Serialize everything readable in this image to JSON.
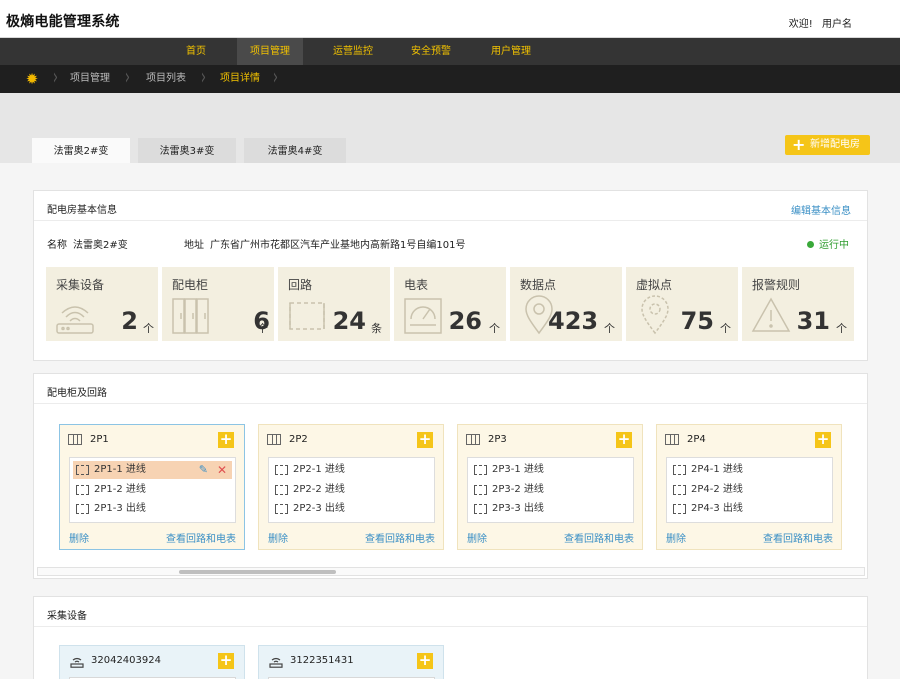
{
  "header": {
    "title": "极熵电能管理系统",
    "welcome": "欢迎!",
    "username": "用户名"
  },
  "nav": {
    "items": [
      "首页",
      "项目管理",
      "运营监控",
      "安全预警",
      "用户管理"
    ],
    "active": "项目管理"
  },
  "breadcrumb": {
    "items": [
      "项目管理",
      "项目列表",
      "项目详情"
    ]
  },
  "tabs": [
    "法雷奥2#变",
    "法雷奥3#变",
    "法雷奥4#变"
  ],
  "add_room_label": "新增配电房",
  "basic": {
    "title": "配电房基本信息",
    "edit_label": "编辑基本信息",
    "name_label": "名称",
    "name": "法雷奥2#变",
    "address_label": "地址",
    "address": "广东省广州市花都区汽车产业基地内高新路1号自编101号",
    "status": "运行中"
  },
  "stats": [
    {
      "label": "采集设备",
      "value": "2",
      "unit": "个",
      "icon": "wifi-router-icon"
    },
    {
      "label": "配电柜",
      "value": "6",
      "unit": "个",
      "icon": "cabinet-icon"
    },
    {
      "label": "回路",
      "value": "24",
      "unit": "条",
      "icon": "loop-icon"
    },
    {
      "label": "电表",
      "value": "26",
      "unit": "个",
      "icon": "meter-icon"
    },
    {
      "label": "数据点",
      "value": "423",
      "unit": "个",
      "icon": "map-pin-icon"
    },
    {
      "label": "虚拟点",
      "value": "75",
      "unit": "个",
      "icon": "virtual-point-icon"
    },
    {
      "label": "报警规则",
      "value": "31",
      "unit": "个",
      "icon": "warning-icon"
    }
  ],
  "cabinets": {
    "title": "配电柜及回路",
    "delete_label": "删除",
    "view_label": "查看回路和电表",
    "items": [
      {
        "name": "2P1",
        "loops": [
          "2P1-1 进线",
          "2P1-2 进线",
          "2P1-3 出线"
        ]
      },
      {
        "name": "2P2",
        "loops": [
          "2P2-1 进线",
          "2P2-2 进线",
          "2P2-3 出线"
        ]
      },
      {
        "name": "2P3",
        "loops": [
          "2P3-1 进线",
          "2P3-2 进线",
          "2P3-3 出线"
        ]
      },
      {
        "name": "2P4",
        "loops": [
          "2P4-1 进线",
          "2P4-2 进线",
          "2P4-3 出线"
        ]
      }
    ]
  },
  "devices": {
    "title": "采集设备",
    "items": [
      {
        "name": "32042403924"
      },
      {
        "name": "3122351431"
      }
    ]
  },
  "colors": {
    "accent": "#f5c518",
    "nav_bg": "#343434",
    "crumb_bg": "#1f1f1f",
    "link": "#3a8fc5",
    "status": "#2e9c2e"
  }
}
